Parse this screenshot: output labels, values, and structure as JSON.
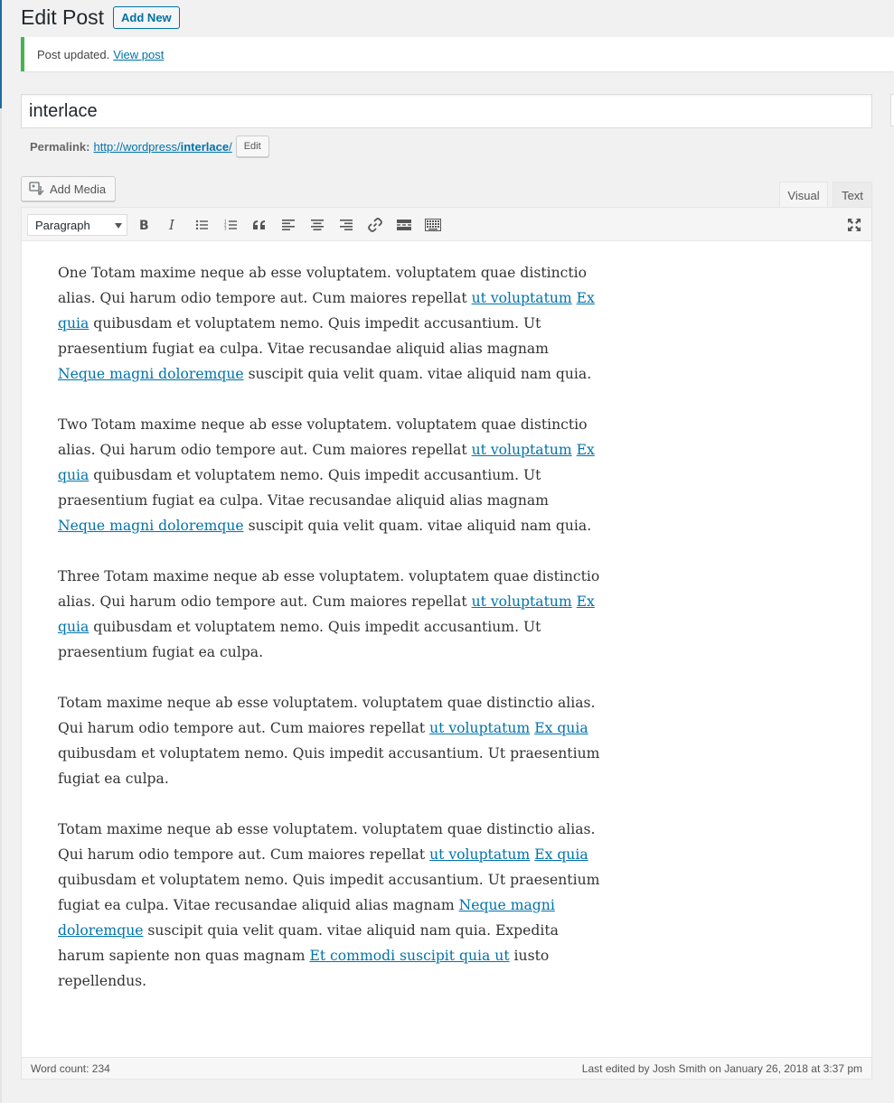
{
  "header": {
    "title": "Edit Post",
    "add_new": "Add New"
  },
  "notice": {
    "text": "Post updated.",
    "link": "View post",
    "accent": "#46b450"
  },
  "post": {
    "title": "interlace",
    "permalink_label": "Permalink:",
    "permalink_base": "http://wordpress/",
    "permalink_slug": "interlace",
    "permalink_trail": "/",
    "edit_label": "Edit"
  },
  "editor": {
    "add_media": "Add Media",
    "tabs": {
      "visual": "Visual",
      "text": "Text"
    },
    "format": "Paragraph",
    "toolbar_icons": [
      "bold-icon",
      "italic-icon",
      "bulleted-list-icon",
      "numbered-list-icon",
      "blockquote-icon",
      "align-left-icon",
      "align-center-icon",
      "align-right-icon",
      "link-icon",
      "read-more-icon",
      "toolbar-toggle-icon",
      "fullscreen-icon"
    ],
    "paragraphs": [
      [
        {
          "t": "One Totam maxime neque ab esse voluptatem. voluptatem quae distinctio alias. Qui harum odio tempore aut. Cum maiores repellat "
        },
        {
          "t": "ut voluptatum",
          "link": true
        },
        {
          "t": " "
        },
        {
          "t": "Ex quia",
          "link": true
        },
        {
          "t": " quibusdam et voluptatem nemo. Quis impedit accusantium. Ut praesentium fugiat ea culpa. Vitae recusandae aliquid alias magnam "
        },
        {
          "t": "Neque magni doloremque",
          "link": true
        },
        {
          "t": " suscipit quia velit quam. vitae aliquid nam quia."
        }
      ],
      [
        {
          "t": "Two Totam maxime neque ab esse voluptatem. voluptatem quae distinctio alias. Qui harum odio tempore aut. Cum maiores repellat "
        },
        {
          "t": "ut voluptatum",
          "link": true
        },
        {
          "t": " "
        },
        {
          "t": "Ex quia",
          "link": true
        },
        {
          "t": " quibusdam et voluptatem nemo. Quis impedit accusantium. Ut praesentium fugiat ea culpa. Vitae recusandae aliquid alias magnam "
        },
        {
          "t": "Neque magni doloremque",
          "link": true
        },
        {
          "t": " suscipit quia velit quam. vitae aliquid nam quia."
        }
      ],
      [
        {
          "t": "Three Totam maxime neque ab esse voluptatem. voluptatem quae distinctio alias. Qui harum odio tempore aut. Cum maiores repellat "
        },
        {
          "t": "ut voluptatum",
          "link": true
        },
        {
          "t": " "
        },
        {
          "t": "Ex quia",
          "link": true
        },
        {
          "t": " quibusdam et voluptatem nemo. Quis impedit accusantium. Ut praesentium fugiat ea culpa."
        }
      ],
      [
        {
          "t": "Totam maxime neque ab esse voluptatem. voluptatem quae distinctio alias. Qui harum odio tempore aut. Cum maiores repellat "
        },
        {
          "t": "ut voluptatum",
          "link": true
        },
        {
          "t": " "
        },
        {
          "t": "Ex quia",
          "link": true
        },
        {
          "t": " quibusdam et voluptatem nemo. Quis impedit accusantium. Ut praesentium fugiat ea culpa."
        }
      ],
      [
        {
          "t": "Totam maxime neque ab esse voluptatem. voluptatem quae distinctio alias. Qui harum odio tempore aut. Cum maiores repellat "
        },
        {
          "t": "ut voluptatum",
          "link": true
        },
        {
          "t": " "
        },
        {
          "t": "Ex quia",
          "link": true
        },
        {
          "t": " quibusdam et voluptatem nemo. Quis impedit accusantium. Ut praesentium fugiat ea culpa. Vitae recusandae aliquid alias magnam "
        },
        {
          "t": "Neque magni doloremque",
          "link": true
        },
        {
          "t": " suscipit quia velit quam. vitae aliquid nam quia. Expedita harum sapiente non quas magnam "
        },
        {
          "t": "Et commodi suscipit quia ut",
          "link": true
        },
        {
          "t": " iusto repellendus."
        }
      ]
    ],
    "word_count": "Word count: 234",
    "last_edited": "Last edited by Josh Smith on January 26, 2018 at 3:37 pm"
  },
  "colors": {
    "link": "#0073aa",
    "primary": "#0071a1"
  }
}
